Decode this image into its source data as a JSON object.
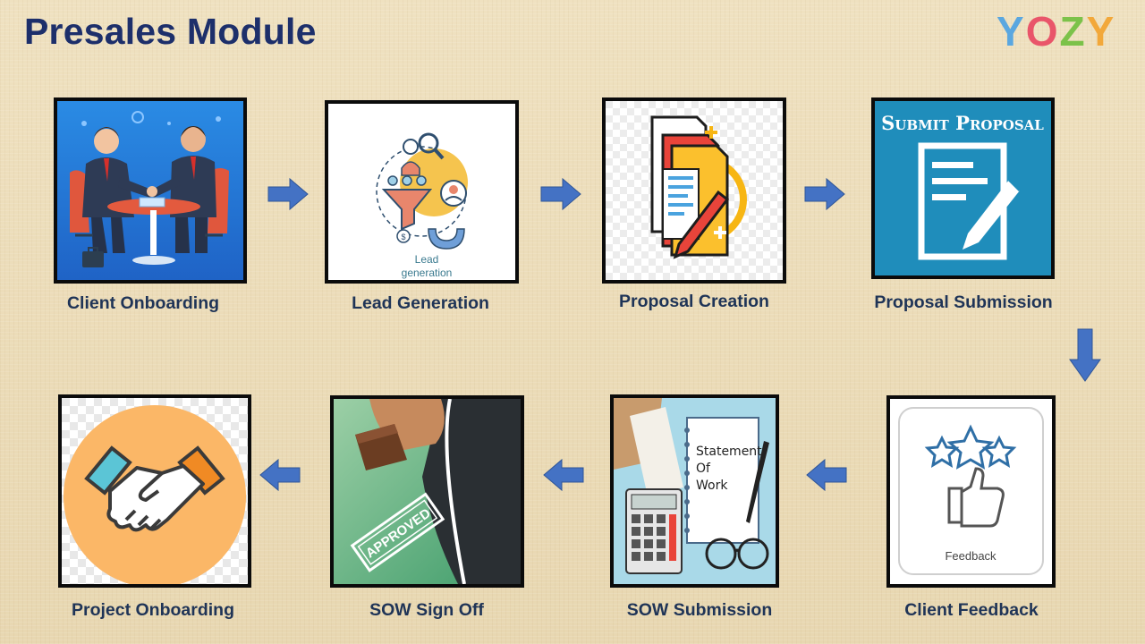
{
  "title": "Presales Module",
  "logo": {
    "letters": [
      "Y",
      "O",
      "Z",
      "Y"
    ],
    "colors": [
      "#5aa7e0",
      "#e9556a",
      "#7cc24a",
      "#f2a83a"
    ]
  },
  "steps": [
    {
      "label": "Client Onboarding"
    },
    {
      "label": "Lead Generation",
      "image_text_1": "Lead",
      "image_text_2": "generation"
    },
    {
      "label": "Proposal Creation"
    },
    {
      "label": "Proposal Submission",
      "image_text": "Submit Proposal"
    },
    {
      "label": "Client Feedback",
      "image_text": "Feedback"
    },
    {
      "label": "SOW Submission",
      "image_text_1": "Statement",
      "image_text_2": "Of",
      "image_text_3": "Work"
    },
    {
      "label": "SOW Sign Off",
      "image_text": "APPROVED"
    },
    {
      "label": "Project Onboarding"
    }
  ],
  "colors": {
    "title": "#1d2f6b",
    "label": "#1f3457",
    "arrow": "#4472c4",
    "background": "#ecdcb7"
  },
  "icons": [
    "business-meeting-icon",
    "lead-funnel-icon",
    "documents-pencil-icon",
    "submit-form-icon",
    "thumbs-up-stars-icon",
    "calculator-documents-icon",
    "approved-stamp-icon",
    "handshake-icon"
  ]
}
